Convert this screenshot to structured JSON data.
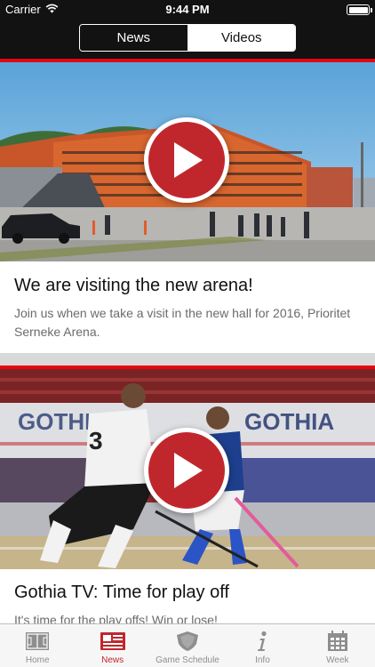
{
  "status_bar": {
    "carrier": "Carrier",
    "time": "9:44 PM"
  },
  "segmented_control": {
    "selected": "News",
    "options": [
      "News",
      "Videos"
    ]
  },
  "feed": [
    {
      "title": "We are visiting the new arena!",
      "description": "Join us when we take a visit in the new hall for 2016, Prioritet Serneke Arena."
    },
    {
      "title": "Gothia TV: Time for play off",
      "description": "It's time for the play offs! Win or lose!",
      "banner_text": "GOTHIA"
    }
  ],
  "tab_bar": {
    "selected": "News",
    "items": [
      {
        "label": "Home",
        "icon": "court-icon"
      },
      {
        "label": "News",
        "icon": "newspaper-icon"
      },
      {
        "label": "Game Schedule",
        "icon": "shield-icon"
      },
      {
        "label": "Info",
        "icon": "info-icon"
      },
      {
        "label": "Week",
        "icon": "calendar-icon"
      }
    ]
  },
  "colors": {
    "accent": "#e30613",
    "play_button": "#c0272d",
    "header": "#121212"
  }
}
